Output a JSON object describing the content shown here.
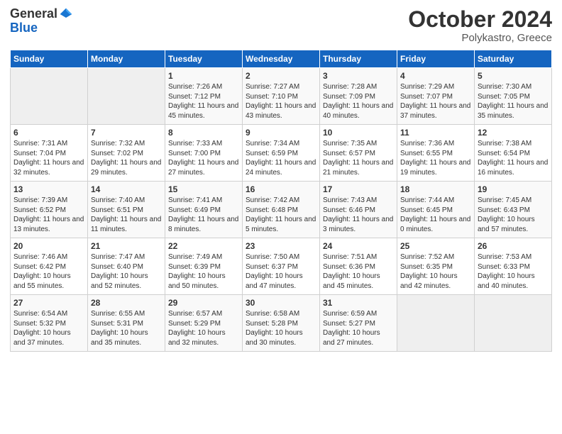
{
  "logo": {
    "general": "General",
    "blue": "Blue"
  },
  "header": {
    "month": "October 2024",
    "location": "Polykastro, Greece"
  },
  "days_of_week": [
    "Sunday",
    "Monday",
    "Tuesday",
    "Wednesday",
    "Thursday",
    "Friday",
    "Saturday"
  ],
  "weeks": [
    [
      {
        "day": "",
        "sunrise": "",
        "sunset": "",
        "daylight": "",
        "empty": true
      },
      {
        "day": "",
        "sunrise": "",
        "sunset": "",
        "daylight": "",
        "empty": true
      },
      {
        "day": "1",
        "sunrise": "Sunrise: 7:26 AM",
        "sunset": "Sunset: 7:12 PM",
        "daylight": "Daylight: 11 hours and 45 minutes.",
        "empty": false
      },
      {
        "day": "2",
        "sunrise": "Sunrise: 7:27 AM",
        "sunset": "Sunset: 7:10 PM",
        "daylight": "Daylight: 11 hours and 43 minutes.",
        "empty": false
      },
      {
        "day": "3",
        "sunrise": "Sunrise: 7:28 AM",
        "sunset": "Sunset: 7:09 PM",
        "daylight": "Daylight: 11 hours and 40 minutes.",
        "empty": false
      },
      {
        "day": "4",
        "sunrise": "Sunrise: 7:29 AM",
        "sunset": "Sunset: 7:07 PM",
        "daylight": "Daylight: 11 hours and 37 minutes.",
        "empty": false
      },
      {
        "day": "5",
        "sunrise": "Sunrise: 7:30 AM",
        "sunset": "Sunset: 7:05 PM",
        "daylight": "Daylight: 11 hours and 35 minutes.",
        "empty": false
      }
    ],
    [
      {
        "day": "6",
        "sunrise": "Sunrise: 7:31 AM",
        "sunset": "Sunset: 7:04 PM",
        "daylight": "Daylight: 11 hours and 32 minutes.",
        "empty": false
      },
      {
        "day": "7",
        "sunrise": "Sunrise: 7:32 AM",
        "sunset": "Sunset: 7:02 PM",
        "daylight": "Daylight: 11 hours and 29 minutes.",
        "empty": false
      },
      {
        "day": "8",
        "sunrise": "Sunrise: 7:33 AM",
        "sunset": "Sunset: 7:00 PM",
        "daylight": "Daylight: 11 hours and 27 minutes.",
        "empty": false
      },
      {
        "day": "9",
        "sunrise": "Sunrise: 7:34 AM",
        "sunset": "Sunset: 6:59 PM",
        "daylight": "Daylight: 11 hours and 24 minutes.",
        "empty": false
      },
      {
        "day": "10",
        "sunrise": "Sunrise: 7:35 AM",
        "sunset": "Sunset: 6:57 PM",
        "daylight": "Daylight: 11 hours and 21 minutes.",
        "empty": false
      },
      {
        "day": "11",
        "sunrise": "Sunrise: 7:36 AM",
        "sunset": "Sunset: 6:55 PM",
        "daylight": "Daylight: 11 hours and 19 minutes.",
        "empty": false
      },
      {
        "day": "12",
        "sunrise": "Sunrise: 7:38 AM",
        "sunset": "Sunset: 6:54 PM",
        "daylight": "Daylight: 11 hours and 16 minutes.",
        "empty": false
      }
    ],
    [
      {
        "day": "13",
        "sunrise": "Sunrise: 7:39 AM",
        "sunset": "Sunset: 6:52 PM",
        "daylight": "Daylight: 11 hours and 13 minutes.",
        "empty": false
      },
      {
        "day": "14",
        "sunrise": "Sunrise: 7:40 AM",
        "sunset": "Sunset: 6:51 PM",
        "daylight": "Daylight: 11 hours and 11 minutes.",
        "empty": false
      },
      {
        "day": "15",
        "sunrise": "Sunrise: 7:41 AM",
        "sunset": "Sunset: 6:49 PM",
        "daylight": "Daylight: 11 hours and 8 minutes.",
        "empty": false
      },
      {
        "day": "16",
        "sunrise": "Sunrise: 7:42 AM",
        "sunset": "Sunset: 6:48 PM",
        "daylight": "Daylight: 11 hours and 5 minutes.",
        "empty": false
      },
      {
        "day": "17",
        "sunrise": "Sunrise: 7:43 AM",
        "sunset": "Sunset: 6:46 PM",
        "daylight": "Daylight: 11 hours and 3 minutes.",
        "empty": false
      },
      {
        "day": "18",
        "sunrise": "Sunrise: 7:44 AM",
        "sunset": "Sunset: 6:45 PM",
        "daylight": "Daylight: 11 hours and 0 minutes.",
        "empty": false
      },
      {
        "day": "19",
        "sunrise": "Sunrise: 7:45 AM",
        "sunset": "Sunset: 6:43 PM",
        "daylight": "Daylight: 10 hours and 57 minutes.",
        "empty": false
      }
    ],
    [
      {
        "day": "20",
        "sunrise": "Sunrise: 7:46 AM",
        "sunset": "Sunset: 6:42 PM",
        "daylight": "Daylight: 10 hours and 55 minutes.",
        "empty": false
      },
      {
        "day": "21",
        "sunrise": "Sunrise: 7:47 AM",
        "sunset": "Sunset: 6:40 PM",
        "daylight": "Daylight: 10 hours and 52 minutes.",
        "empty": false
      },
      {
        "day": "22",
        "sunrise": "Sunrise: 7:49 AM",
        "sunset": "Sunset: 6:39 PM",
        "daylight": "Daylight: 10 hours and 50 minutes.",
        "empty": false
      },
      {
        "day": "23",
        "sunrise": "Sunrise: 7:50 AM",
        "sunset": "Sunset: 6:37 PM",
        "daylight": "Daylight: 10 hours and 47 minutes.",
        "empty": false
      },
      {
        "day": "24",
        "sunrise": "Sunrise: 7:51 AM",
        "sunset": "Sunset: 6:36 PM",
        "daylight": "Daylight: 10 hours and 45 minutes.",
        "empty": false
      },
      {
        "day": "25",
        "sunrise": "Sunrise: 7:52 AM",
        "sunset": "Sunset: 6:35 PM",
        "daylight": "Daylight: 10 hours and 42 minutes.",
        "empty": false
      },
      {
        "day": "26",
        "sunrise": "Sunrise: 7:53 AM",
        "sunset": "Sunset: 6:33 PM",
        "daylight": "Daylight: 10 hours and 40 minutes.",
        "empty": false
      }
    ],
    [
      {
        "day": "27",
        "sunrise": "Sunrise: 6:54 AM",
        "sunset": "Sunset: 5:32 PM",
        "daylight": "Daylight: 10 hours and 37 minutes.",
        "empty": false
      },
      {
        "day": "28",
        "sunrise": "Sunrise: 6:55 AM",
        "sunset": "Sunset: 5:31 PM",
        "daylight": "Daylight: 10 hours and 35 minutes.",
        "empty": false
      },
      {
        "day": "29",
        "sunrise": "Sunrise: 6:57 AM",
        "sunset": "Sunset: 5:29 PM",
        "daylight": "Daylight: 10 hours and 32 minutes.",
        "empty": false
      },
      {
        "day": "30",
        "sunrise": "Sunrise: 6:58 AM",
        "sunset": "Sunset: 5:28 PM",
        "daylight": "Daylight: 10 hours and 30 minutes.",
        "empty": false
      },
      {
        "day": "31",
        "sunrise": "Sunrise: 6:59 AM",
        "sunset": "Sunset: 5:27 PM",
        "daylight": "Daylight: 10 hours and 27 minutes.",
        "empty": false
      },
      {
        "day": "",
        "sunrise": "",
        "sunset": "",
        "daylight": "",
        "empty": true
      },
      {
        "day": "",
        "sunrise": "",
        "sunset": "",
        "daylight": "",
        "empty": true
      }
    ]
  ]
}
